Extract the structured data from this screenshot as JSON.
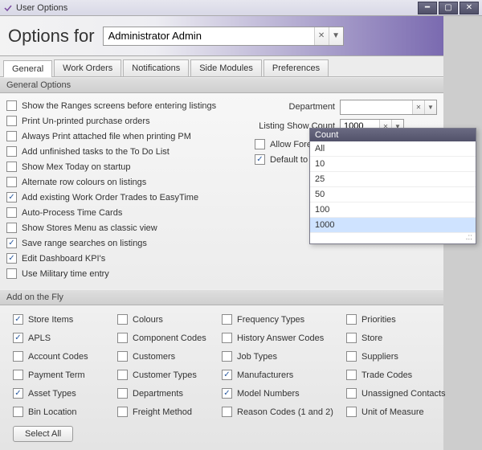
{
  "window": {
    "title": "User Options"
  },
  "header": {
    "prefix": "Options for",
    "user_value": "Administrator Admin"
  },
  "tabs": [
    {
      "label": "General",
      "active": true
    },
    {
      "label": "Work Orders",
      "active": false
    },
    {
      "label": "Notifications",
      "active": false
    },
    {
      "label": "Side Modules",
      "active": false
    },
    {
      "label": "Preferences",
      "active": false
    }
  ],
  "sections": {
    "general_options_title": "General Options",
    "add_on_fly_title": "Add on the Fly"
  },
  "general_left": [
    {
      "label": "Show the Ranges screens before entering listings",
      "checked": false
    },
    {
      "label": "Print Un-printed purchase orders",
      "checked": false
    },
    {
      "label": "Always Print attached file when printing PM",
      "checked": false
    },
    {
      "label": "Add unfinished tasks to the To Do List",
      "checked": false
    },
    {
      "label": "Show Mex Today on startup",
      "checked": false
    },
    {
      "label": "Alternate row colours on listings",
      "checked": false
    },
    {
      "label": "Add existing Work Order Trades to EasyTime",
      "checked": true
    },
    {
      "label": "Auto-Process Time Cards",
      "checked": false
    },
    {
      "label": "Show Stores Menu as classic view",
      "checked": false
    },
    {
      "label": "Save range searches on listings",
      "checked": true
    },
    {
      "label": "Edit Dashboard KPI's",
      "checked": true
    },
    {
      "label": "Use Military time entry",
      "checked": false
    }
  ],
  "general_right": {
    "department_label": "Department",
    "department_value": "",
    "listing_label": "Listing Show Count",
    "listing_value": "1000",
    "allow_foreign": {
      "label": "Allow Foreign Char",
      "checked": false
    },
    "default_full": {
      "label": "Default to Full Scre",
      "checked": true
    }
  },
  "dropdown": {
    "header": "Count",
    "items": [
      "All",
      "10",
      "25",
      "50",
      "100",
      "1000"
    ],
    "selected": "1000"
  },
  "add_on_fly": {
    "cols": [
      [
        {
          "label": "Store Items",
          "checked": true
        },
        {
          "label": "APLS",
          "checked": true
        },
        {
          "label": "Account Codes",
          "checked": false
        },
        {
          "label": "Payment Term",
          "checked": false
        },
        {
          "label": "Asset Types",
          "checked": true
        },
        {
          "label": "Bin Location",
          "checked": false
        }
      ],
      [
        {
          "label": "Colours",
          "checked": false
        },
        {
          "label": "Component Codes",
          "checked": false
        },
        {
          "label": "Customers",
          "checked": false
        },
        {
          "label": "Customer Types",
          "checked": false
        },
        {
          "label": "Departments",
          "checked": false
        },
        {
          "label": "Freight Method",
          "checked": false
        }
      ],
      [
        {
          "label": "Frequency Types",
          "checked": false
        },
        {
          "label": "History Answer Codes",
          "checked": false
        },
        {
          "label": "Job Types",
          "checked": false
        },
        {
          "label": "Manufacturers",
          "checked": true
        },
        {
          "label": "Model Numbers",
          "checked": true
        },
        {
          "label": "Reason Codes (1 and 2)",
          "checked": false
        }
      ],
      [
        {
          "label": "Priorities",
          "checked": false
        },
        {
          "label": "Store",
          "checked": false
        },
        {
          "label": "Suppliers",
          "checked": false
        },
        {
          "label": "Trade Codes",
          "checked": false
        },
        {
          "label": "Unassigned Contacts",
          "checked": false
        },
        {
          "label": "Unit of Measure",
          "checked": false
        }
      ]
    ],
    "select_all_label": "Select All"
  }
}
